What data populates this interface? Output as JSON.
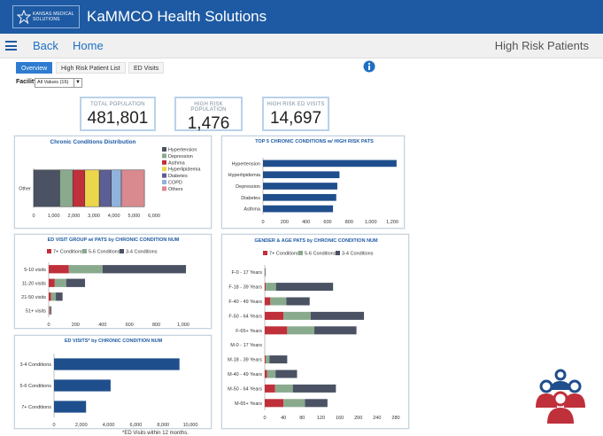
{
  "app": {
    "logo_line1": "KANSAS MEDICAL",
    "logo_line2": "SOLUTIONS",
    "title": "KaMMCO Health Solutions"
  },
  "nav": {
    "back": "Back",
    "home": "Home",
    "page": "High Risk Patients"
  },
  "tabs": [
    {
      "label": "Overview",
      "active": true
    },
    {
      "label": "High Risk Patient List",
      "active": false
    },
    {
      "label": "ED Visits",
      "active": false
    }
  ],
  "facility": {
    "label": "Facility",
    "value": "All Values (16)"
  },
  "kpis": [
    {
      "label": "TOTAL POPULATION",
      "value": "481,801"
    },
    {
      "label": "HIGH RISK POPULATION",
      "value": "1,476"
    },
    {
      "label": "HIGH RISK ED VISITS",
      "value": "14,697"
    }
  ],
  "footnote": "*ED Visits within 12 months.",
  "colors": {
    "brand": "#1e5aa3",
    "navy": "#1f4e8c",
    "red": "#c0303a",
    "green": "#8aaa8e",
    "slate": "#4a5263",
    "yellow": "#ecd64b",
    "purple": "#5b5f93",
    "lightblue": "#8fb3dc",
    "pink": "#d98a8e"
  },
  "chart_data": [
    {
      "id": "chronic",
      "type": "bar",
      "title": "Chronic Conditions Distribution",
      "orientation": "horizontal-stacked",
      "categories": [
        "Other"
      ],
      "series": [
        {
          "name": "Hypertension",
          "values": [
            1300
          ],
          "color": "#4a5263"
        },
        {
          "name": "Depression",
          "values": [
            650
          ],
          "color": "#8aaa8e"
        },
        {
          "name": "Asthma",
          "values": [
            600
          ],
          "color": "#c0303a"
        },
        {
          "name": "Hyperlipidemia",
          "values": [
            720
          ],
          "color": "#ecd64b"
        },
        {
          "name": "Diabetes",
          "values": [
            600
          ],
          "color": "#5b5f93"
        },
        {
          "name": "COPD",
          "values": [
            500
          ],
          "color": "#8fb3dc"
        },
        {
          "name": "Others",
          "values": [
            1150
          ],
          "color": "#d98a8e"
        }
      ],
      "xlim": [
        0,
        6000
      ],
      "xticks": [
        "0",
        "1,000",
        "2,000",
        "3,000",
        "4,000",
        "5,000",
        "6,000"
      ]
    },
    {
      "id": "top5",
      "type": "bar",
      "title": "TOP 5 CHRONIC CONDITIONS w/ HIGH RISK PATS",
      "orientation": "horizontal",
      "categories": [
        "Hypertension",
        "Hyperlipidemia",
        "Depression",
        "Diabetes",
        "Asthma"
      ],
      "values": [
        1240,
        710,
        690,
        680,
        650
      ],
      "color": "#1f4e8c",
      "xlim": [
        0,
        1200
      ],
      "xticks": [
        "0",
        "200",
        "400",
        "600",
        "800",
        "1,000",
        "1,200"
      ]
    },
    {
      "id": "edgroup",
      "type": "bar",
      "title": "ED VISIT GROUP w/ PATS by CHRONIC CONDITION NUM",
      "orientation": "horizontal-stacked",
      "categories": [
        "5-10 visits",
        "11-20 visits",
        "21-50 visits",
        "51+ visits"
      ],
      "series": [
        {
          "name": "7+ Conditions",
          "values": [
            150,
            45,
            18,
            5
          ],
          "color": "#c0303a"
        },
        {
          "name": "5-6 Conditions",
          "values": [
            250,
            85,
            35,
            7
          ],
          "color": "#8aaa8e"
        },
        {
          "name": "3-4 Conditions",
          "values": [
            620,
            140,
            50,
            8
          ],
          "color": "#4a5263"
        }
      ],
      "xlim": [
        0,
        1000
      ],
      "xticks": [
        "0",
        "200",
        "400",
        "600",
        "800",
        "1,000"
      ]
    },
    {
      "id": "gender",
      "type": "bar",
      "title": "GENDER & AGE PATS by CHRONIC CONDITION NUM",
      "orientation": "horizontal-stacked",
      "categories": [
        "F-0 - 17 Years",
        "F-18 - 39 Years",
        "F-40 - 49 Years",
        "F-50 - 64 Years",
        "F-65+ Years",
        "M-0 - 17 Years",
        "M-18 - 39 Years",
        "M-40 - 49 Years",
        "M-50 - 64 Years",
        "M-65+ Years"
      ],
      "series": [
        {
          "name": "7+ Conditions",
          "values": [
            0,
            2,
            12,
            40,
            48,
            0,
            2,
            5,
            22,
            40
          ],
          "color": "#c0303a"
        },
        {
          "name": "5-6 Conditions",
          "values": [
            1,
            22,
            34,
            58,
            58,
            0,
            8,
            18,
            38,
            46
          ],
          "color": "#8aaa8e"
        },
        {
          "name": "3-4 Conditions",
          "values": [
            1,
            122,
            50,
            114,
            90,
            0,
            38,
            46,
            92,
            48
          ],
          "color": "#4a5263"
        }
      ],
      "xlim": [
        0,
        280
      ],
      "xticks": [
        "0",
        "40",
        "80",
        "120",
        "160",
        "200",
        "240",
        "280"
      ]
    },
    {
      "id": "edvisits",
      "type": "bar",
      "title": "ED VISITS* by CHRONIC CONDITION NUM",
      "orientation": "horizontal",
      "categories": [
        "3-4 Conditions",
        "5-6 Conditions",
        "7+ Conditions"
      ],
      "values": [
        9200,
        4150,
        2350
      ],
      "color": "#1f4e8c",
      "xlim": [
        0,
        10000
      ],
      "xticks": [
        "0",
        "2,000",
        "4,000",
        "6,000",
        "8,000",
        "10,000"
      ]
    }
  ]
}
